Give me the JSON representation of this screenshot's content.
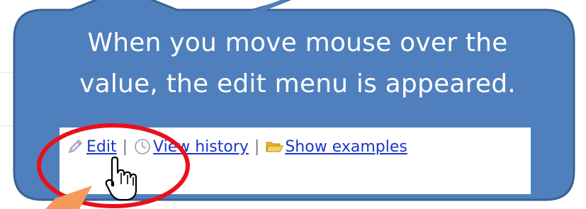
{
  "callout": {
    "line1": "When you move mouse over the",
    "line2": "value, the edit menu is appeared."
  },
  "menu": {
    "edit_label": "Edit",
    "separator": "|",
    "history_label": "View history",
    "examples_label": "Show examples"
  },
  "icons": {
    "edit": "pencil-icon",
    "history": "clock-icon",
    "examples": "open-folder-icon",
    "cursor": "hand-pointer-icon"
  },
  "colors": {
    "callout_fill": "#4f80bd",
    "callout_border": "#3a6292",
    "link": "#1a35cc",
    "highlight_ring": "#e8101a",
    "pointer_arrow": "#f59a5a"
  }
}
